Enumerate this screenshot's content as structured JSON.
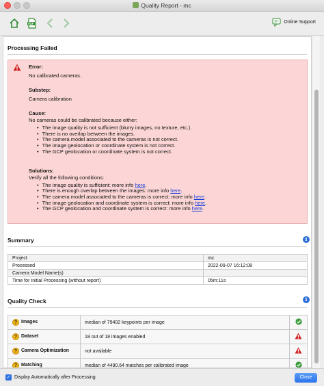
{
  "window": {
    "title": "Quality Report - mc"
  },
  "toolbar": {
    "online_support": "Online Support"
  },
  "processing": {
    "heading": "Processing Failed",
    "error_label": "Error:",
    "error_text": "No calibrated cameras.",
    "substep_label": "Substep:",
    "substep_text": "Camera calibration",
    "cause_label": "Cause:",
    "cause_intro": "No cameras could be calibrated because either:",
    "causes": [
      "The image quality is not sufficient (blurry images, no texture, etc.).",
      "There is no overlap between the images.",
      "The camera model associated to the cameras is not correct.",
      "The image geolocation or coordinate system is not correct.",
      "The GCP geolocation or coordinate system is not correct."
    ],
    "solutions_label": "Solutions:",
    "solutions_intro": "Verify all the following conditions:",
    "solutions": [
      "The image quality is sufficient: more info ",
      "There is enough overlap between the images: more info ",
      "The camera model associated to the cameras is correct: more info ",
      "The image geolocation and coordinate system is correct: more info ",
      "The GCP geolocation and coordinate system is correct: more info "
    ],
    "link_text": "here",
    "link_suffix": "."
  },
  "summary": {
    "heading": "Summary",
    "rows": [
      {
        "key": "Project",
        "value": "mc"
      },
      {
        "key": "Processed",
        "value": "2022-09-07 16:12:08"
      },
      {
        "key": "Camera Model Name(s)",
        "value": ""
      },
      {
        "key": "Time for Initial Processing (without report)",
        "value": "05m:11s"
      }
    ]
  },
  "quality": {
    "heading": "Quality Check",
    "rows": [
      {
        "key": "Images",
        "value": "median of 79402 keypoints per image",
        "status": "ok"
      },
      {
        "key": "Dataset",
        "value": "18 out of 18 images enabled",
        "status": "warn"
      },
      {
        "key": "Camera Optimization",
        "value": "not available",
        "status": "warn"
      },
      {
        "key": "Matching",
        "value": "median of 4490.64 matches per calibrated image",
        "status": "ok"
      }
    ]
  },
  "footer": {
    "auto_display": "Display Automatically after Processing",
    "close": "Close"
  },
  "colors": {
    "error_bg": "#fcd6d6",
    "accent": "#2d72e0",
    "ok": "#3a9b3a",
    "warn": "#d22020"
  }
}
